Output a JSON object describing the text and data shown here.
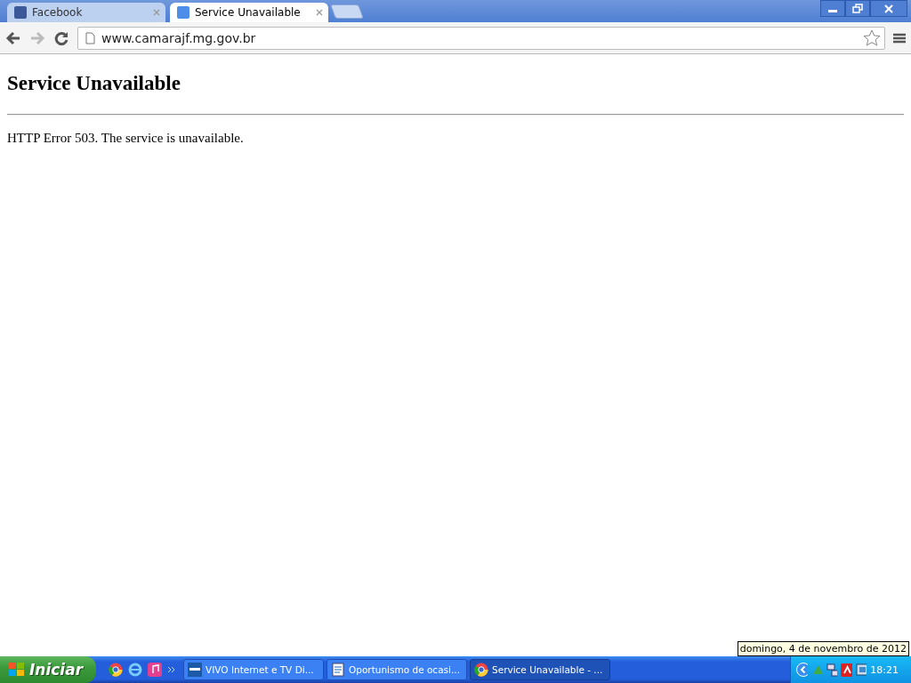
{
  "tabs": [
    {
      "title": "Facebook",
      "selected": false
    },
    {
      "title": "Service Unavailable",
      "selected": true
    }
  ],
  "address": "www.camarajf.mg.gov.br",
  "page": {
    "heading": "Service Unavailable",
    "message": "HTTP Error 503. The service is unavailable."
  },
  "taskbar": {
    "start_label": "Iniciar",
    "tasks": [
      {
        "label": "VIVO Internet e TV Di...",
        "selected": false
      },
      {
        "label": "Oportunismo de ocasi...",
        "selected": false
      },
      {
        "label": "Service Unavailable - ...",
        "selected": true
      }
    ],
    "clock": "18:21",
    "tooltip": "domingo, 4 de novembro de 2012"
  }
}
